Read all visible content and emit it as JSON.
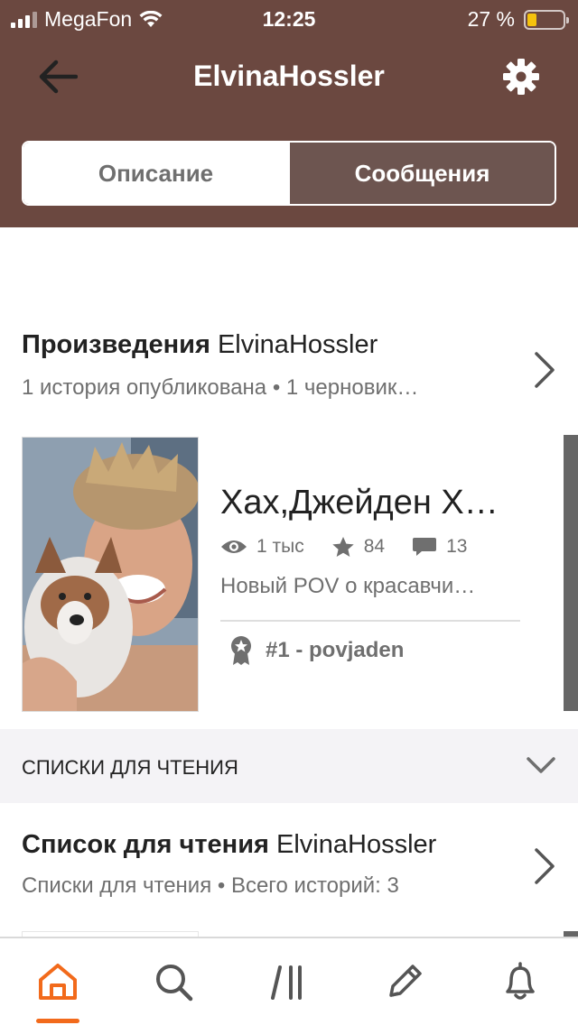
{
  "status_bar": {
    "carrier": "MegaFon",
    "time": "12:25",
    "battery_percent": "27 %",
    "battery_level": 0.27
  },
  "header": {
    "title": "ElvinaHossler",
    "tabs": [
      {
        "label": "Описание",
        "active": false
      },
      {
        "label": "Сообщения",
        "active": true
      }
    ]
  },
  "works": {
    "title_bold": "Произведения",
    "title_name": "ElvinaHossler",
    "subtitle": "1 история опубликована • 1 черновик…",
    "story": {
      "title": "Хах,Джейден Х…",
      "views": "1 тыс",
      "votes": "84",
      "comments": "13",
      "description": "Новый POV о красавчи…",
      "rank": "#1 - povjaden"
    }
  },
  "reading_lists": {
    "header": "СПИСКИ ДЛЯ ЧТЕНИЯ",
    "item": {
      "title_bold": "Список для чтения",
      "title_name": "ElvinaHossler",
      "subtitle": "Списки для чтения • Всего историй: 3"
    }
  },
  "tabbar": {
    "items": [
      "home-icon",
      "search-icon",
      "library-icon",
      "write-icon",
      "notifications-icon"
    ],
    "active": "home-icon"
  },
  "colors": {
    "header_bg": "#6b4840",
    "active_segment": "#6d5550",
    "accent": "#f26a1b",
    "battery": "#f4c20d",
    "muted_text": "#6f6f6f"
  }
}
